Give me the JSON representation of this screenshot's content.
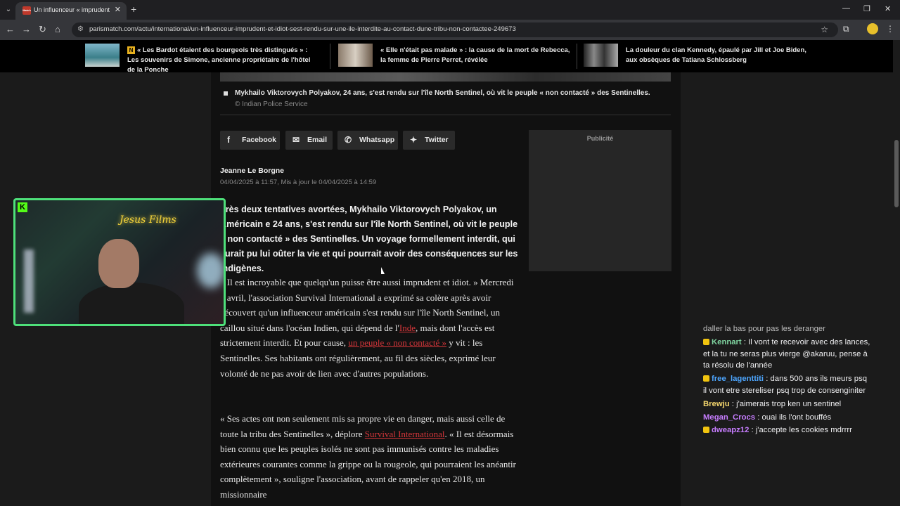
{
  "browser": {
    "tab_title": "Un influenceur « imprudent et i",
    "url": "parismatch.com/actu/international/un-influenceur-imprudent-et-idiot-sest-rendu-sur-une-ile-interdite-au-contact-dune-tribu-non-contactee-249673",
    "favicon_label": "Match"
  },
  "ticker": {
    "items": [
      {
        "badge": "N",
        "text": "« Les Bardot étaient des bourgeois très distingués » : Les souvenirs de Simone, ancienne propriétaire de l'hôtel de la Ponche"
      },
      {
        "text": "« Elle n'était pas malade » : la cause de la mort de Rebecca, la femme de Pierre Perret, révélée"
      },
      {
        "text": "La douleur du clan Kennedy, épaulé par Jill et Joe Biden, aux obsèques de Tatiana Schlossberg"
      }
    ]
  },
  "article": {
    "caption": "Mykhailo Viktorovych Polyakov, 24 ans, s'est rendu sur l'île North Sentinel, où vit le peuple « non contacté » des Sentinelles.",
    "caption_credit": "© Indian Police Service",
    "share": {
      "facebook": "Facebook",
      "email": "Email",
      "whatsapp": "Whatsapp",
      "twitter": "Twitter"
    },
    "author": "Jeanne Le Borgne",
    "dates": "04/04/2025 à 11:57, Mis à jour le 04/04/2025 à 14:59",
    "lead": "près deux tentatives avortées, Mykhailo Viktorovych Polyakov, un Américain e 24 ans, s'est rendu sur l'île North Sentinel, où vit le peuple « non contacté » des Sentinelles. Un voyage formellement interdit, qui aurait pu lui oûter la vie et qui pourrait avoir des conséquences sur les indigènes.",
    "p1_a": " Il est incroyable que quelqu'un puisse être aussi imprudent et idiot. » Mercredi 2 avril, l'association Survival International a exprimé sa colère après avoir découvert qu'un influenceur américain s'est rendu sur l'île North Sentinel, un caillou situé dans l'océan Indien, qui dépend de l'",
    "p1_link1": "Inde",
    "p1_b": ", mais dont l'accès est strictement interdit. Et pour cause, ",
    "p1_link2": "un peuple « non contacté »",
    "p1_c": " y vit : les Sentinelles. Ses habitants ont régulièrement, au fil des siècles, exprimé leur volonté de ne pas avoir de lien avec d'autres populations.",
    "p2_a": "« Ses actes ont non seulement mis sa propre vie en danger, mais aussi celle de toute la tribu des Sentinelles », déplore ",
    "p2_link": "Survival International",
    "p2_b": ". « Il est désormais bien connu que les peuples isolés ne sont pas immunisés contre les maladies extérieures courantes comme la grippe ou la rougeole, qui pourraient les anéantir complètement », souligne l'association, avant de rappeler qu'en 2018, un missionnaire",
    "ad_label": "Publicité"
  },
  "webcam": {
    "neon_text": "Jesus Films"
  },
  "chat": {
    "partial": "daller la bas pour pas les deranger",
    "messages": [
      {
        "user": "Kennart",
        "color": "#7fd4a0",
        "text": "Il vont te recevoir avec des lances, et la tu ne seras plus vierge @akaruu, pense à ta résolu de l'année"
      },
      {
        "user": "free_lagenttiti",
        "color": "#4da6ff",
        "text": "dans 500 ans ils meurs psq il vont etre stereliser psq trop de consenginiter"
      },
      {
        "user": "Brewju",
        "color": "#f5d76e",
        "text": "j'aimerais trop ken un sentinel"
      },
      {
        "user": "Megan_Crocs",
        "color": "#c77dff",
        "text": "ouai ils l'ont bouffés"
      },
      {
        "user": "dweapz12",
        "color": "#c77dff",
        "text": "j'accepte les cookies mdrrrr"
      }
    ]
  },
  "colors": {
    "accent_link": "#d6363a",
    "webcam_border": "#4ee07a"
  }
}
